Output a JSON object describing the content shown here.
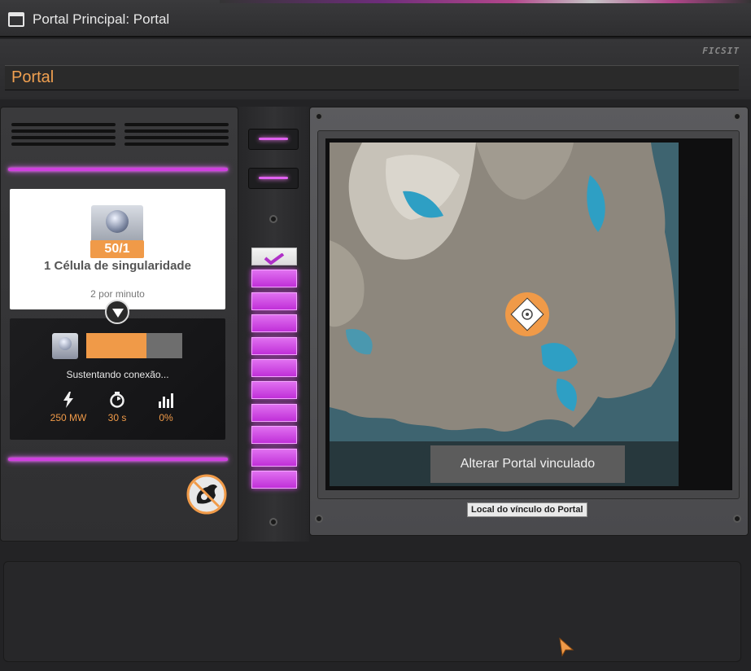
{
  "window": {
    "title": "Portal Principal: Portal",
    "brand": "FICSIT"
  },
  "header": {
    "building_name": "Portal"
  },
  "recipe": {
    "count": "50/1",
    "name": "1 Célula de singularidade",
    "rate": "2 por minuto",
    "item_icon": "singularity-cell-icon"
  },
  "status": {
    "text": "Sustentando conexão...",
    "progress_fraction": 0.63,
    "stats": [
      {
        "icon": "power-icon",
        "value": "250 MW"
      },
      {
        "icon": "timer-icon",
        "value": "30 s"
      },
      {
        "icon": "productivity-icon",
        "value": "0%"
      }
    ]
  },
  "power_segments": {
    "total": 11,
    "filled": 11
  },
  "map": {
    "change_button": "Alterar Portal vinculado",
    "tooltip": "Local do vínculo do Portal"
  },
  "colors": {
    "accent_orange": "#f09a48",
    "neon_purple": "#d040e0"
  }
}
